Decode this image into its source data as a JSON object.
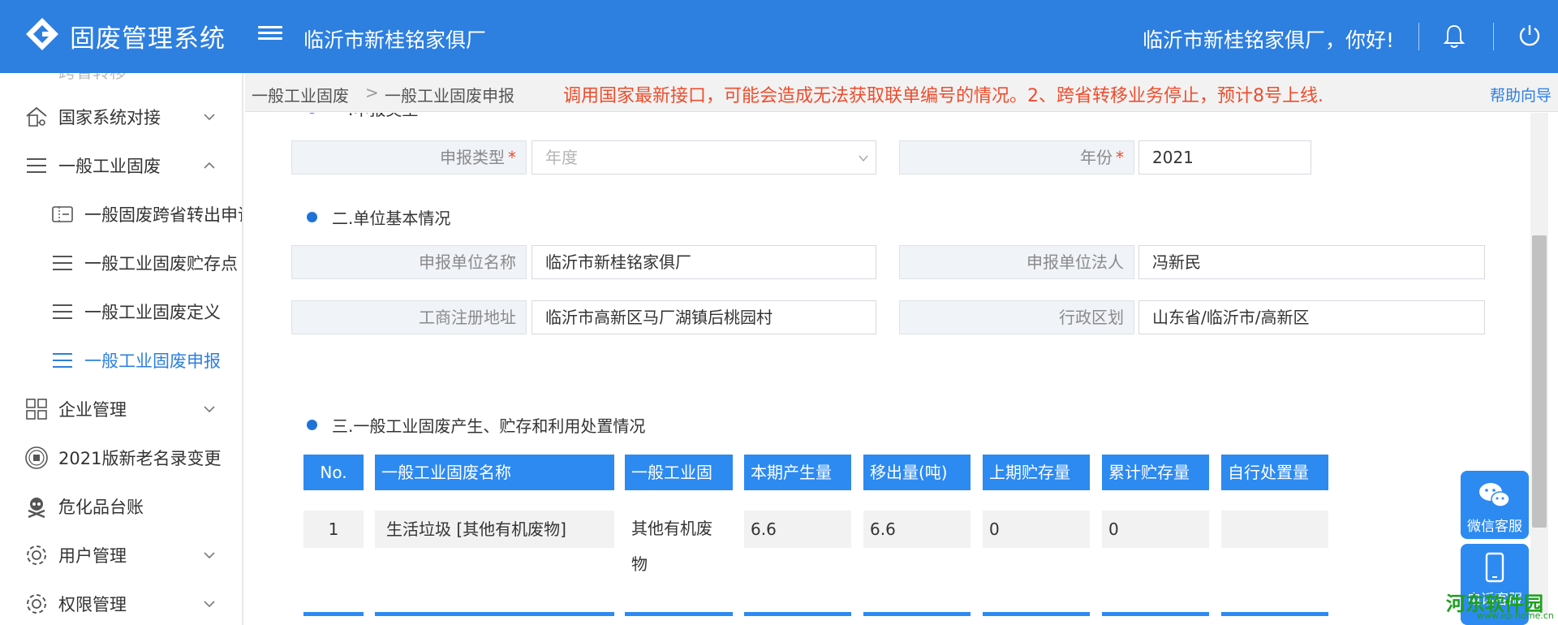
{
  "header": {
    "app_title": "固废管理系统",
    "org_name": "临沂市新桂铭家俱厂",
    "greeting": "临沂市新桂铭家俱厂，你好!",
    "accent": "#2d7fe0"
  },
  "sidebar": {
    "partial_top_label": "跨省转移",
    "items": [
      {
        "label": "国家系统对接",
        "icon": "building-network-icon"
      },
      {
        "label": "一般工业固废",
        "icon": "list-icon"
      },
      {
        "label": "一般固废跨省转出申请",
        "icon": "ticket-icon"
      },
      {
        "label": "一般工业固废贮存点",
        "icon": "list-icon"
      },
      {
        "label": "一般工业固废定义",
        "icon": "list-icon"
      },
      {
        "label": "一般工业固废申报",
        "icon": "list-icon"
      },
      {
        "label": "企业管理",
        "icon": "grid-icon"
      },
      {
        "label": "2021版新老名录变更",
        "icon": "seal-icon"
      },
      {
        "label": "危化品台账",
        "icon": "skull-icon"
      },
      {
        "label": "用户管理",
        "icon": "gear-icon"
      },
      {
        "label": "权限管理",
        "icon": "gear-icon"
      }
    ]
  },
  "breadcrumb": {
    "level1": "一般工业固废",
    "sep": ">",
    "level2": "一般工业固废申报",
    "notice": "调用国家最新接口，可能会造成无法获取联单编号的情况。2、跨省转移业务停止，预计8号上线.",
    "help": "帮助向导"
  },
  "form": {
    "section1_title": "一.申报类型",
    "report_type_label": "申报类型",
    "report_type_placeholder": "年度",
    "year_label": "年份",
    "year_value": "2021",
    "required_mark": "*",
    "section2_title": "二.单位基本情况",
    "unit_name_label": "申报单位名称",
    "unit_name_value": "临沂市新桂铭家俱厂",
    "legal_person_label": "申报单位法人",
    "legal_person_value": "冯新民",
    "address_label": "工商注册地址",
    "address_value": "临沂市高新区马厂湖镇后桃园村",
    "region_label": "行政区划",
    "region_value": "山东省/临沂市/高新区",
    "section3_title": "三.一般工业固废产生、贮存和利用处置情况"
  },
  "table": {
    "headers": [
      "No.",
      "一般工业固废名称",
      "一般工业固",
      "本期产生量",
      "移出量(吨)",
      "上期贮存量",
      "累计贮存量",
      "自行处置量"
    ],
    "rows": [
      {
        "no": "1",
        "name": "生活垃圾 [其他有机废物]",
        "category": "其他有机废物",
        "produced": "6.6",
        "moved_out": "6.6",
        "prev_stored": "0",
        "total_stored": "0",
        "self_disposed": ""
      }
    ]
  },
  "float": {
    "wechat_label": "微信客服",
    "phone_label": "电话客服"
  },
  "watermark": {
    "text": "河东软件园",
    "sub": "www.ep-home.cn"
  }
}
